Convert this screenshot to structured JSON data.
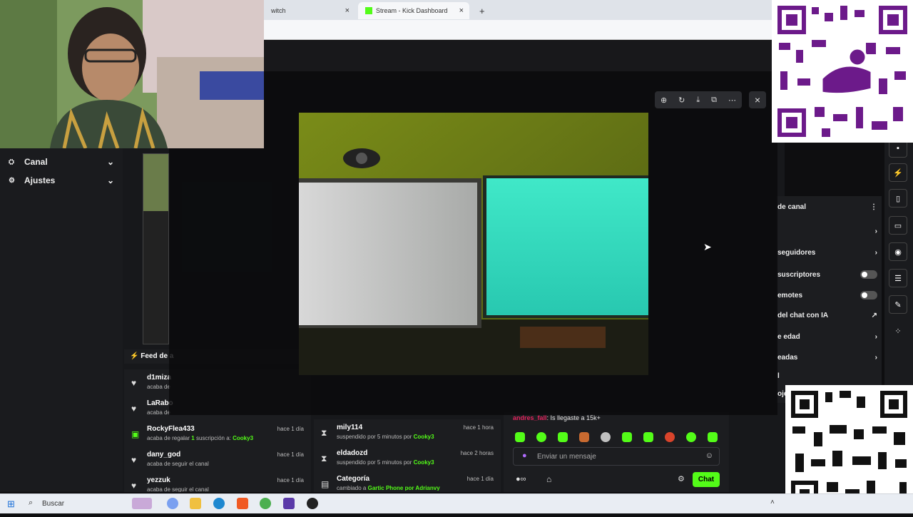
{
  "browser": {
    "tabs": [
      {
        "label": "witch"
      },
      {
        "label": "Stream - Kick Dashboard"
      }
    ],
    "new_tab": "+",
    "close_glyph": "×"
  },
  "left_nav": {
    "items": [
      {
        "label": "Canal",
        "icon": "channel-icon"
      },
      {
        "label": "Ajustes",
        "icon": "gear-icon"
      }
    ]
  },
  "feed": {
    "title": "Feed de a",
    "col1": [
      {
        "name": "d1miza",
        "sub": "acaba de",
        "time": "",
        "icon": "heart-icon"
      },
      {
        "name": "LaRabo",
        "sub": "acaba de",
        "time": "",
        "icon": "heart-icon"
      },
      {
        "name": "RockyFlea433",
        "sub_pre": "acaba de regalar",
        "sub_num": "1",
        "sub_mid": "suscripción a:",
        "sub_target": "Cooky3",
        "time": "hace 1 día",
        "icon": "gift-icon"
      },
      {
        "name": "dany_god",
        "sub": "acaba de seguir el canal",
        "time": "hace 1 día",
        "icon": "heart-icon"
      },
      {
        "name": "yezzuk",
        "sub": "acaba de seguir el canal",
        "time": "hace 1 día",
        "icon": "heart-icon"
      }
    ],
    "col2": [
      {
        "name": "mily114",
        "sub_pre": "suspendido por 5 minutos por",
        "sub_target": "Cooky3",
        "time": "hace 1 hora",
        "icon": "hourglass-icon"
      },
      {
        "name": "eldadozd",
        "sub_pre": "suspendido por 5 minutos por",
        "sub_target": "Cooky3",
        "time": "hace 2 horas",
        "icon": "hourglass-icon"
      },
      {
        "name": "Categoría",
        "sub_pre": "cambiado a",
        "sub_target": "Gartic Phone por Adrianvy",
        "time": "hace 1 día",
        "icon": "category-icon"
      }
    ]
  },
  "chat": {
    "last_message_user": "andres_fall",
    "last_message_text": ": Is llegaste a 15k+",
    "input_placeholder": "Enviar un mensaje",
    "send_label": "Chat"
  },
  "right_panel": {
    "header": "de canal",
    "rows": [
      {
        "label": "seguidores",
        "end": "chevron"
      },
      {
        "label": "suscriptores",
        "end": "toggle"
      },
      {
        "label": "emotes",
        "end": "toggle"
      },
      {
        "label": "del chat con IA",
        "end": "external"
      },
      {
        "label": "e edad",
        "end": "chevron"
      },
      {
        "label": "eadas",
        "end": "chevron"
      },
      {
        "label": "l",
        "end": ""
      },
      {
        "label": "oje",
        "end": ""
      }
    ]
  },
  "taskbar": {
    "search_label": "Buscar"
  },
  "colors": {
    "accent": "#53fc18",
    "panel": "#1c1d20",
    "background": "#17181b"
  }
}
